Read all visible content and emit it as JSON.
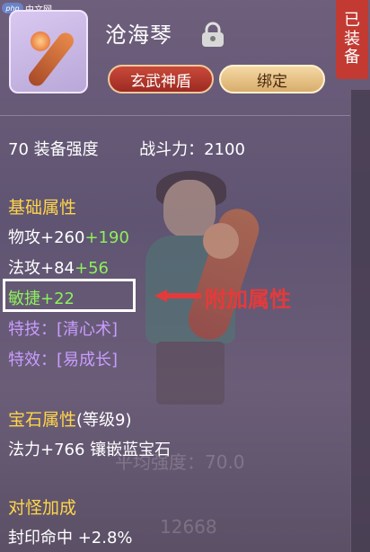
{
  "watermark": {
    "logo": "php",
    "text": "中文网"
  },
  "item": {
    "name": "沧海琴"
  },
  "tags": {
    "primary": "玄武神盾",
    "secondary": "绑定"
  },
  "equipped": [
    "已",
    "装",
    "备"
  ],
  "stats": {
    "strength": "70 装备强度",
    "combat_power": "战斗力：2100"
  },
  "base_attributes": {
    "title": "基础属性",
    "physical": {
      "label": "物攻+260",
      "bonus": "+190"
    },
    "magic": {
      "label": "法攻+84",
      "bonus": "+56"
    },
    "agility": {
      "label": "敏捷",
      "bonus": "+22"
    },
    "skill": "特技：[清心术]",
    "effect": "特效：[易成长]"
  },
  "annotation": "附加属性",
  "gem_attributes": {
    "title": "宝石属性",
    "level": "(等级9)",
    "line": "法力+766 镶嵌蓝宝石"
  },
  "monster_bonus": {
    "title": "对怪加成",
    "line": "封印命中 +2.8%"
  },
  "background_ghost": {
    "line1": "平均强度：70.0",
    "line2": "12668"
  },
  "colors": {
    "accent_yellow": "#ffd54a",
    "bonus_green": "#8cf05a",
    "special_purple": "#c99cff",
    "annotation_red": "#e33b3b",
    "tag_red": "#c23a32"
  },
  "icons": [
    "lock-icon",
    "item-icon",
    "arrow-left-icon"
  ]
}
